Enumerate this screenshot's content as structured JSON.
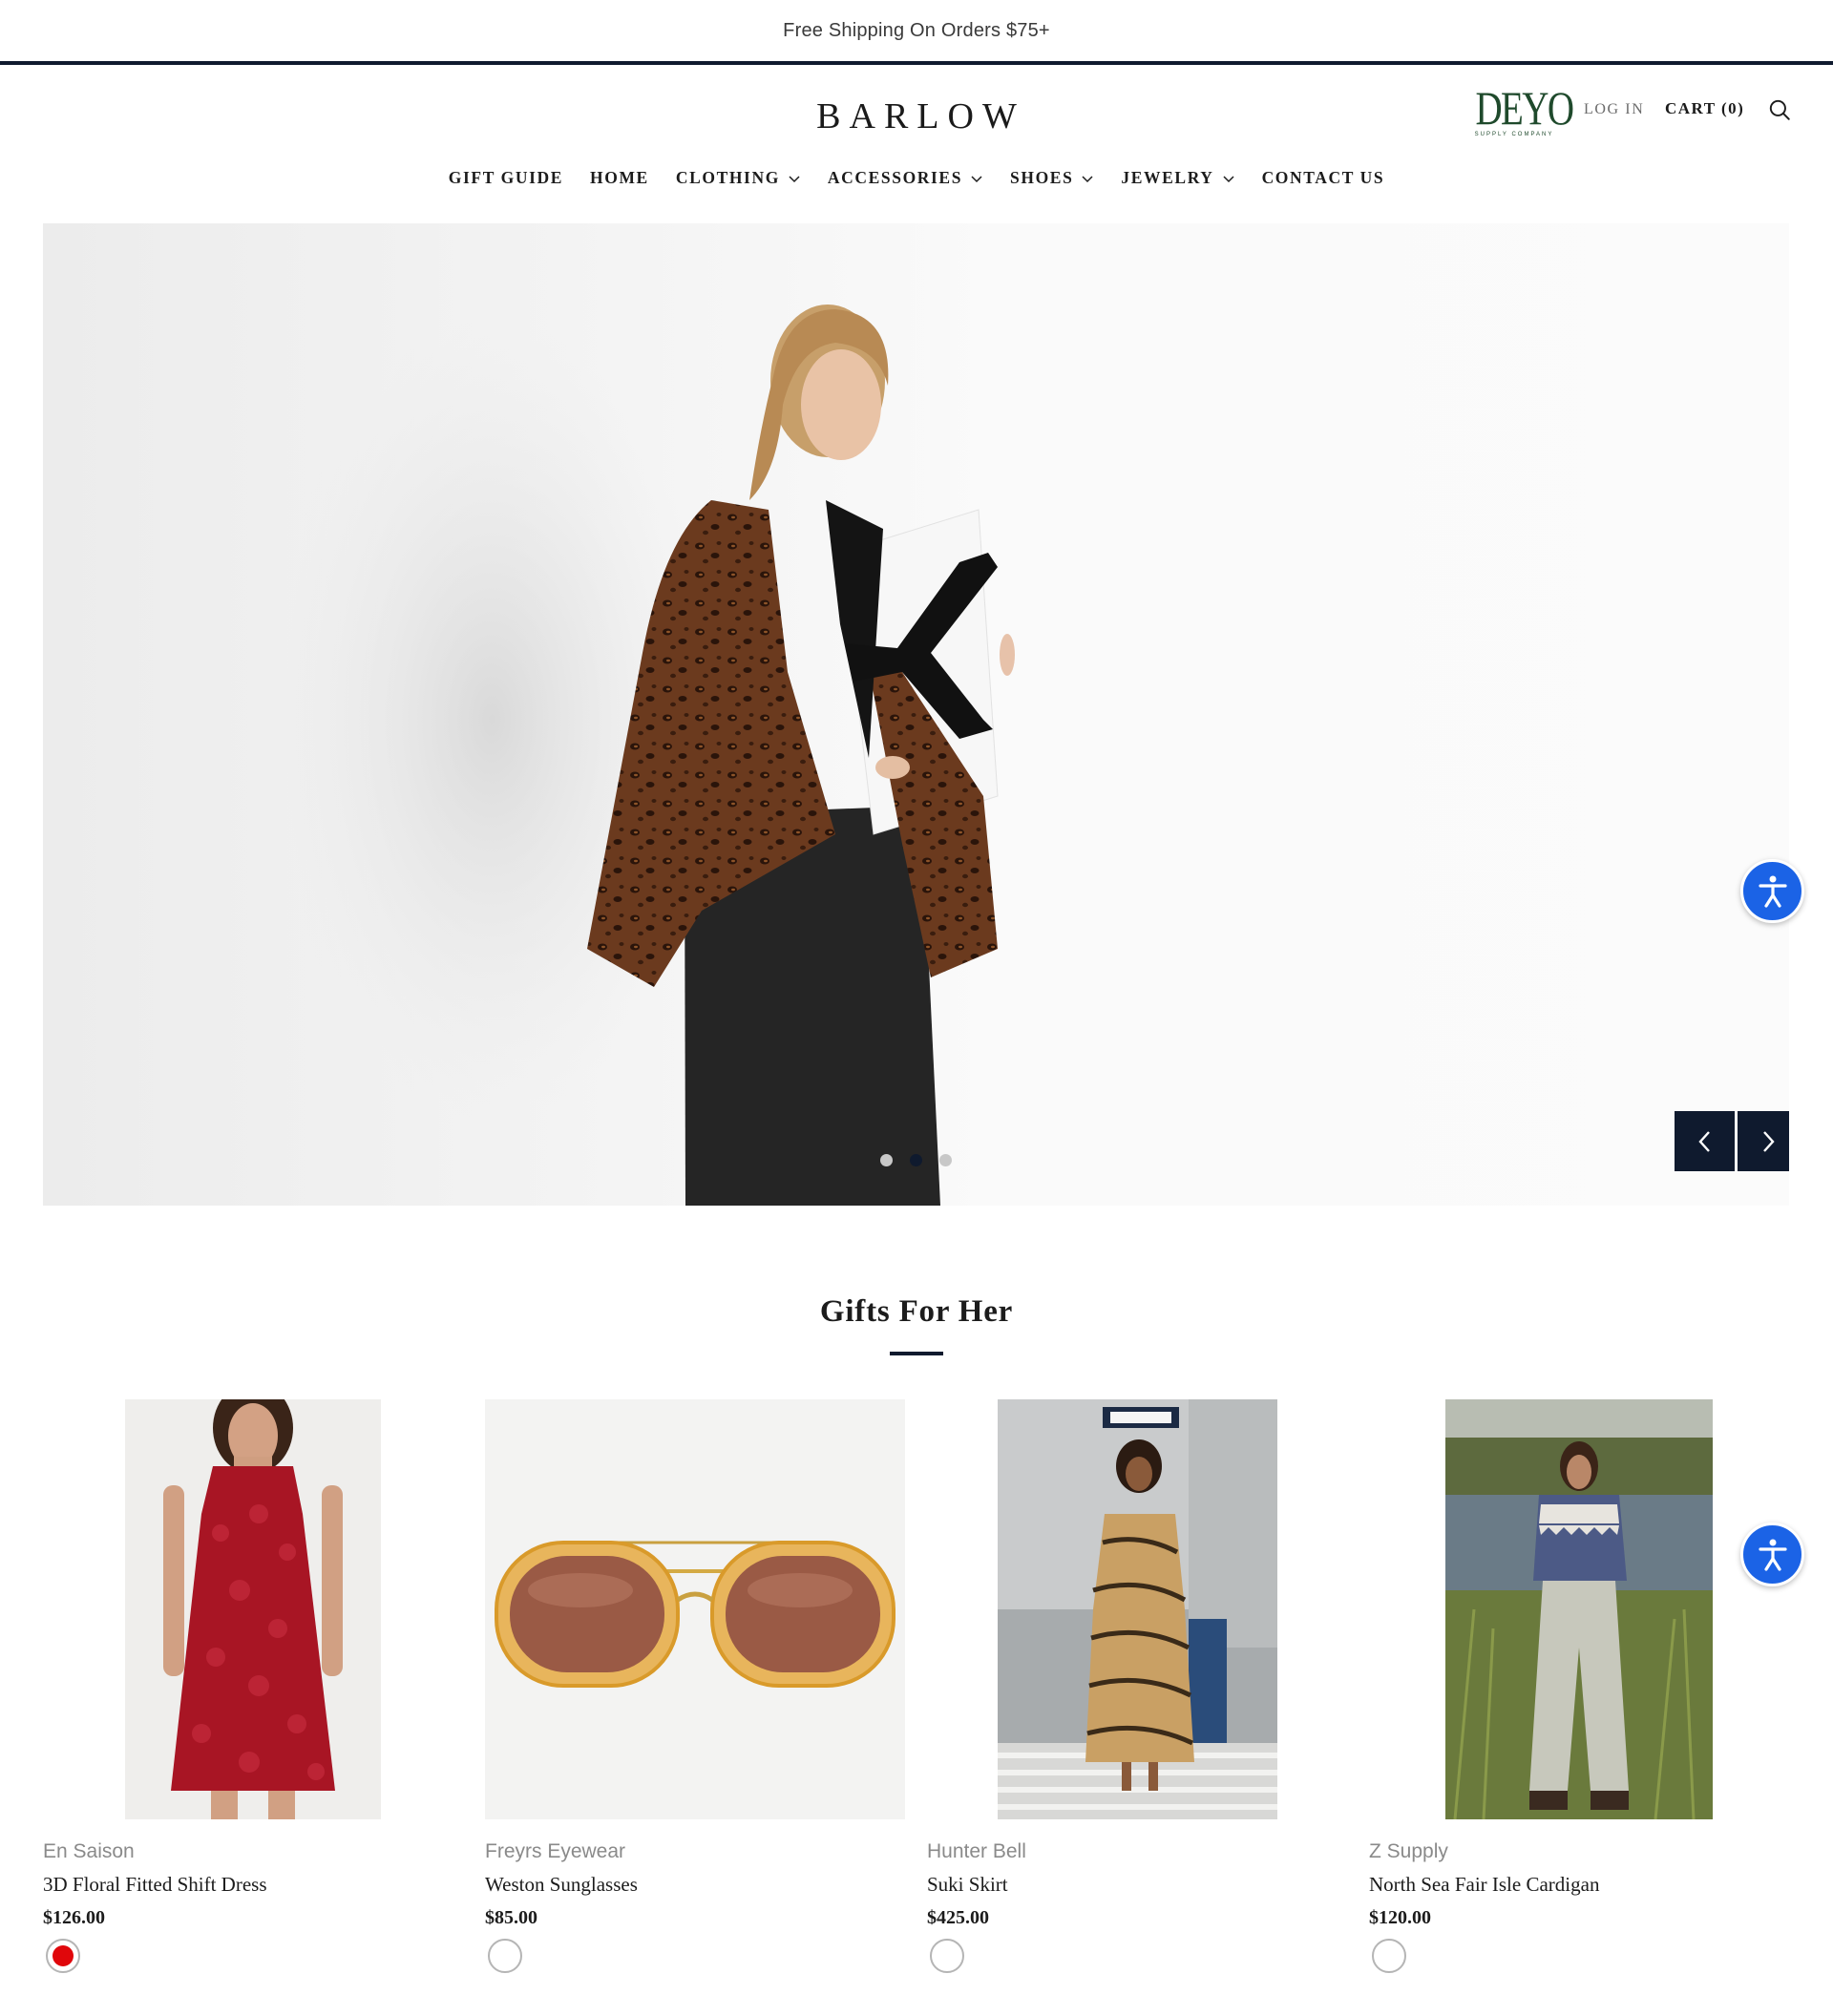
{
  "announcement": "Free Shipping On Orders $75+",
  "header": {
    "logo": "BARLOW",
    "partner_logo": {
      "mark": "DEYO",
      "sub": "SUPPLY COMPANY",
      "color": "#1f4a2c"
    },
    "login_label": "LOG IN",
    "cart_label": "CART (0)",
    "search_icon": "search-icon"
  },
  "nav": {
    "items": [
      {
        "label": "GIFT GUIDE",
        "dropdown": false
      },
      {
        "label": "HOME",
        "dropdown": false
      },
      {
        "label": "CLOTHING",
        "dropdown": true
      },
      {
        "label": "ACCESSORIES",
        "dropdown": true
      },
      {
        "label": "SHOES",
        "dropdown": true
      },
      {
        "label": "JEWELRY",
        "dropdown": true
      },
      {
        "label": "CONTACT US",
        "dropdown": false
      }
    ]
  },
  "hero": {
    "slides_count": 3,
    "active_slide": 2,
    "prev_icon": "chevron-left-icon",
    "next_icon": "chevron-right-icon"
  },
  "accessibility": {
    "icon": "accessibility-icon",
    "color": "#1b63e6"
  },
  "section": {
    "title": "Gifts For Her",
    "products": [
      {
        "vendor": "En Saison",
        "title": "3D Floral Fitted Shift Dress",
        "price": "$126.00",
        "swatch_color": "#e0070b"
      },
      {
        "vendor": "Freyrs Eyewear",
        "title": "Weston Sunglasses",
        "price": "$85.00",
        "swatch_color": "#ffffff"
      },
      {
        "vendor": "Hunter Bell",
        "title": "Suki Skirt",
        "price": "$425.00",
        "swatch_color": "#ffffff"
      },
      {
        "vendor": "Z Supply",
        "title": "North Sea Fair Isle Cardigan",
        "price": "$120.00",
        "swatch_color": "#ffffff"
      }
    ]
  },
  "colors": {
    "navy": "#0f1a2e",
    "text": "#1c1c1c",
    "muted": "#8a8a8a"
  }
}
